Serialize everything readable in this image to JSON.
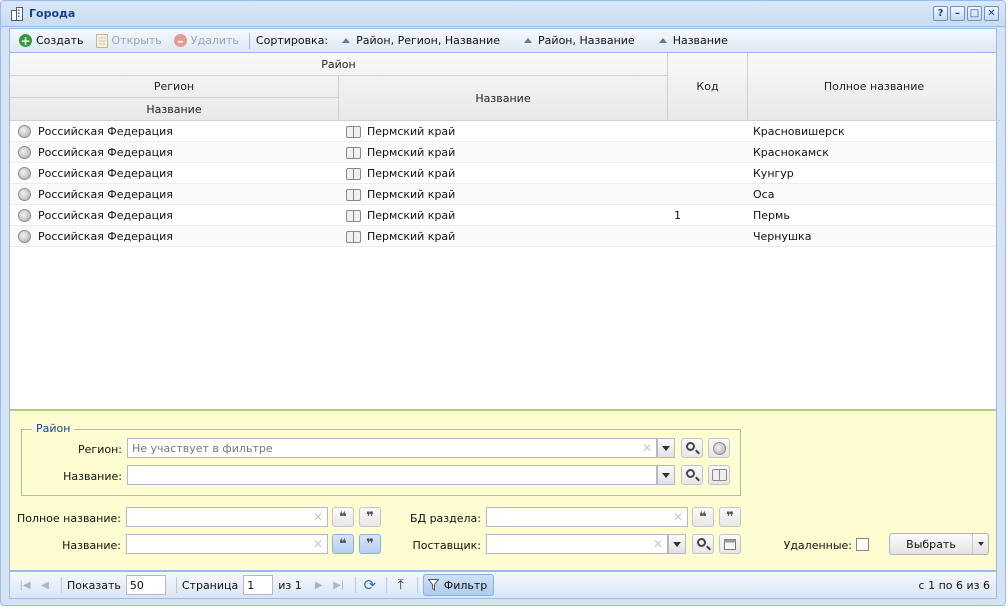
{
  "window": {
    "title": "Города",
    "tools": [
      "?",
      "–",
      "□",
      "✕"
    ]
  },
  "toolbar": {
    "create": "Создать",
    "open": "Открыть",
    "delete": "Удалить",
    "sort_label": "Сортировка:",
    "sort_options": [
      "Район, Регион, Название",
      "Район, Название",
      "Название"
    ]
  },
  "grid": {
    "headers": {
      "group": "Район",
      "region": "Регион",
      "region_name": "Название",
      "name": "Название",
      "code": "Код",
      "full_name": "Полное название"
    },
    "rows": [
      {
        "region": "Российская Федерация",
        "district": "Пермский край",
        "code": "",
        "full_name": "Красновишерск"
      },
      {
        "region": "Российская Федерация",
        "district": "Пермский край",
        "code": "",
        "full_name": "Краснокамск"
      },
      {
        "region": "Российская Федерация",
        "district": "Пермский край",
        "code": "",
        "full_name": "Кунгур"
      },
      {
        "region": "Российская Федерация",
        "district": "Пермский край",
        "code": "",
        "full_name": "Оса"
      },
      {
        "region": "Российская Федерация",
        "district": "Пермский край",
        "code": "1",
        "full_name": "Пермь"
      },
      {
        "region": "Российская Федерация",
        "district": "Пермский край",
        "code": "",
        "full_name": "Чернушка"
      }
    ]
  },
  "filter": {
    "legend": "Район",
    "region_label": "Регион:",
    "region_placeholder": "Не участвует в фильтре",
    "name_label": "Название:",
    "full_name_label": "Полное название:",
    "name2_label": "Название:",
    "db_label": "БД раздела:",
    "supplier_label": "Поставщик:",
    "deleted_label": "Удаленные:",
    "select_button": "Выбрать",
    "quote_open": "❝",
    "quote_close": "❞",
    "clear": "✕"
  },
  "paging": {
    "show_label": "Показать",
    "page_size": "50",
    "page_label": "Страница",
    "page": "1",
    "of_label": "из 1",
    "filter_button": "Фильтр",
    "range_text": "с 1 по 6 из 6"
  }
}
